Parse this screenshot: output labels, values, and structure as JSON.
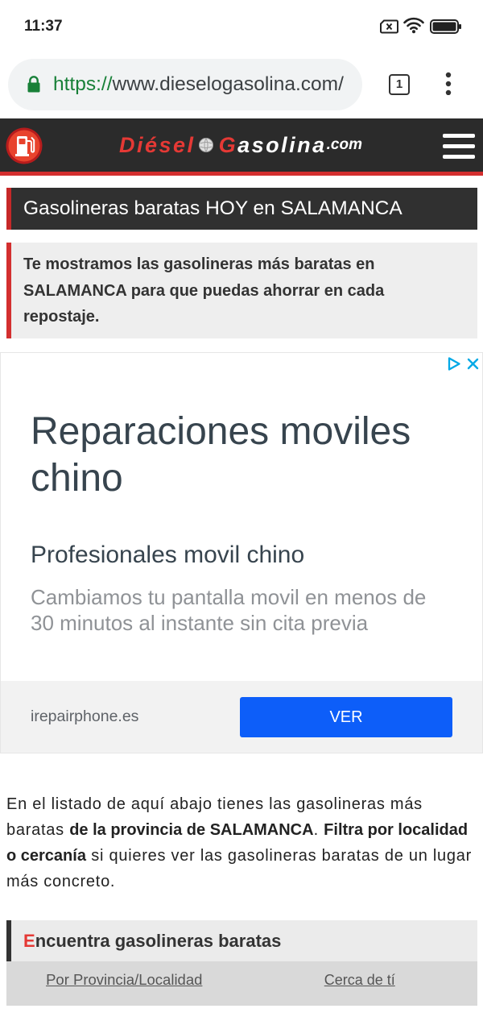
{
  "status_bar": {
    "time": "11:37",
    "icons": [
      "sim-off-icon",
      "wifi-icon",
      "battery-icon"
    ]
  },
  "browser": {
    "url_scheme": "https://",
    "url_host": "www.dieselogasolina.com/",
    "tab_count": "1"
  },
  "site_header": {
    "logo": {
      "word1": "Diésel",
      "word2_initial": "G",
      "word2_rest": "asolina",
      "suffix": ".com"
    }
  },
  "page_title": "Gasolineras baratas HOY en SALAMANCA",
  "intro_text": "Te mostramos las gasolineras más baratas en SALAMANCA para que puedas ahorrar en cada repostaje.",
  "ad": {
    "headline": "Reparaciones moviles chino",
    "subheadline": "Profesionales movil chino",
    "description": "Cambiamos tu pantalla movil en menos de 30 minutos al instante sin cita previa",
    "domain": "irepairphone.es",
    "cta_label": "VER"
  },
  "body_text": {
    "part1": "En el listado de aquí abajo tienes las gasolineras más baratas ",
    "bold1": "de la provincia de SALAMANCA",
    "part2": ". ",
    "bold2": "Filtra por localidad o cercanía",
    "part3": " si quieres ver las gasolineras baratas de un lugar más concreto."
  },
  "finder": {
    "title_initial": "E",
    "title_rest": "ncuentra gasolineras baratas",
    "tabs": [
      {
        "label": "Por Provincia/Localidad"
      },
      {
        "label": "Cerca de tí"
      }
    ]
  },
  "colors": {
    "accent_red": "#d32f2f",
    "header_bg": "#2b2b2b",
    "cta_blue": "#0d5ef9",
    "secure_green": "#188038"
  }
}
